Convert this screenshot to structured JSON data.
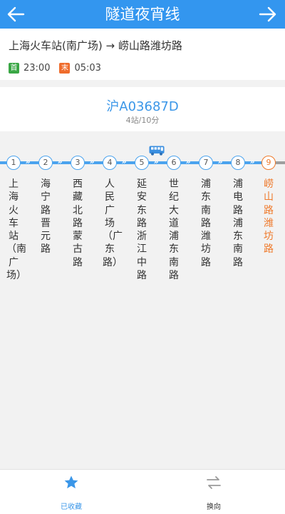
{
  "header": {
    "title": "隧道夜宵线",
    "back_icon": "arrow-left-icon",
    "forward_icon": "arrow-right-icon"
  },
  "route": {
    "from": "上海火车站(南广场)",
    "arrow": "→",
    "to": "崂山路潍坊路",
    "first_label": "首",
    "first_time": "23:00",
    "last_label": "末",
    "last_time": "05:03"
  },
  "vehicle": {
    "plate": "沪A03687D",
    "eta": "4站/10分"
  },
  "stations": [
    {
      "num": "1",
      "name": "上海火车站（南广场）"
    },
    {
      "num": "2",
      "name": "海宁路晋元路"
    },
    {
      "num": "3",
      "name": "西藏北路蒙古路"
    },
    {
      "num": "4",
      "name": "人民广场（广东路）"
    },
    {
      "num": "5",
      "name": "延安东路浙江中路"
    },
    {
      "num": "6",
      "name": "世纪大道浦东南路"
    },
    {
      "num": "7",
      "name": "浦东南路潍坊路"
    },
    {
      "num": "8",
      "name": "浦电路浦东南路"
    },
    {
      "num": "9",
      "name": "崂山路潍坊路"
    }
  ],
  "bottom_nav": {
    "favorite_label": "已收藏",
    "reverse_label": "换向"
  },
  "colors": {
    "primary": "#3396ef",
    "destination": "#ef7a2c",
    "first_badge": "#3aa745",
    "last_badge": "#ef6c2c"
  }
}
